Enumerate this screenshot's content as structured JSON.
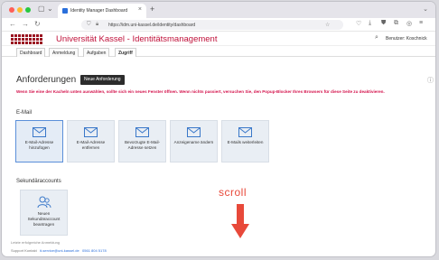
{
  "browser": {
    "tab_title": "Identity Manager Dashboard",
    "url": "https://idm.uni-kassel.de/identity/dashboard"
  },
  "site": {
    "title": "Universität Kassel - Identitätsmanagement",
    "user_label": "Benutzer: Koschnick"
  },
  "subnav": {
    "tabs": [
      "Dashboard",
      "Anmeldung",
      "Aufgaben",
      "Zugriff"
    ],
    "active": "Zugriff"
  },
  "page": {
    "title": "Anforderungen",
    "new_button": "Neue Anforderung",
    "warning": "Wenn Sie eine der Kacheln unten auswählen, sollte sich ein neues Fenster öffnen. Wenn nichts passiert, versuchen Sie, den Popup-Blocker Ihres Browsers für diese Seite zu deaktivieren."
  },
  "email_section": {
    "label": "E-Mail",
    "cards": [
      {
        "label": "E-Mail-Adresse hinzufügen"
      },
      {
        "label": "E-Mail-Adresse entfernen"
      },
      {
        "label": "Bevorzugte E-Mail-Adresse setzen"
      },
      {
        "label": "Anzeigename ändern"
      },
      {
        "label": "E-Mails weiterleiten"
      }
    ]
  },
  "secondary_section": {
    "label": "Sekundäraccounts",
    "cards": [
      {
        "label": "Neuen Sekundäraccount beantragen"
      }
    ]
  },
  "footer": {
    "line1": "Letzte erfolgreiche Anmeldung",
    "line2_text": "Support Kontakt",
    "link1": "it-service@uni-kassel.de",
    "link2": "0561 804 5178"
  },
  "overlay": {
    "scroll_label": "scroll",
    "accent_color": "#e8493a"
  },
  "colors": {
    "brand": "#c0113a",
    "warning": "#d4144d",
    "card_bg": "#e9eef4",
    "icon_blue": "#3a78c9"
  }
}
